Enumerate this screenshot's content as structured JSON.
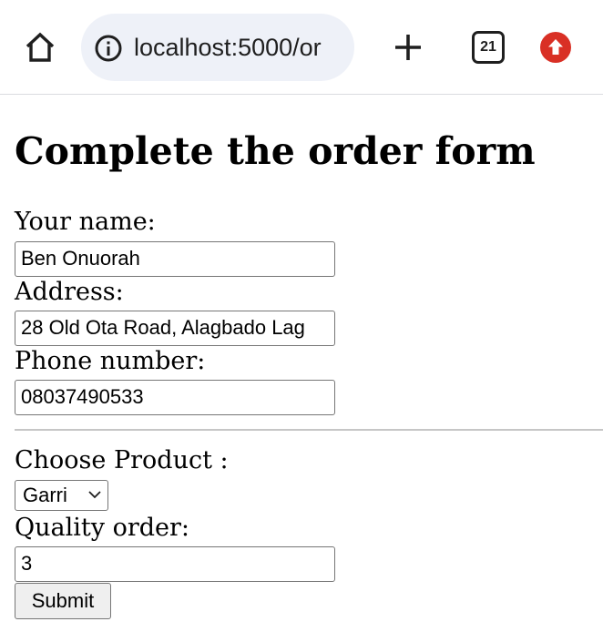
{
  "browser": {
    "url": "localhost:5000/or",
    "tab_count": "21",
    "icons": {
      "home": "home-icon",
      "info": "info-icon",
      "new_tab": "plus-icon",
      "tabs": "tab-switcher-icon",
      "update": "update-arrow-icon"
    },
    "colors": {
      "omnibox_bg": "#eef1f8",
      "update_badge": "#d93025"
    }
  },
  "form": {
    "title": "Complete the order form",
    "name_label": "Your name:",
    "name_value": "Ben Onuorah",
    "address_label": "Address:",
    "address_value": "28 Old Ota Road, Alagbado Lag",
    "phone_label": "Phone number:",
    "phone_value": "08037490533",
    "product_label": "Choose Product :",
    "product_selected": "Garri",
    "quantity_label": "Quality order:",
    "quantity_value": "3",
    "submit_label": "Submit"
  }
}
